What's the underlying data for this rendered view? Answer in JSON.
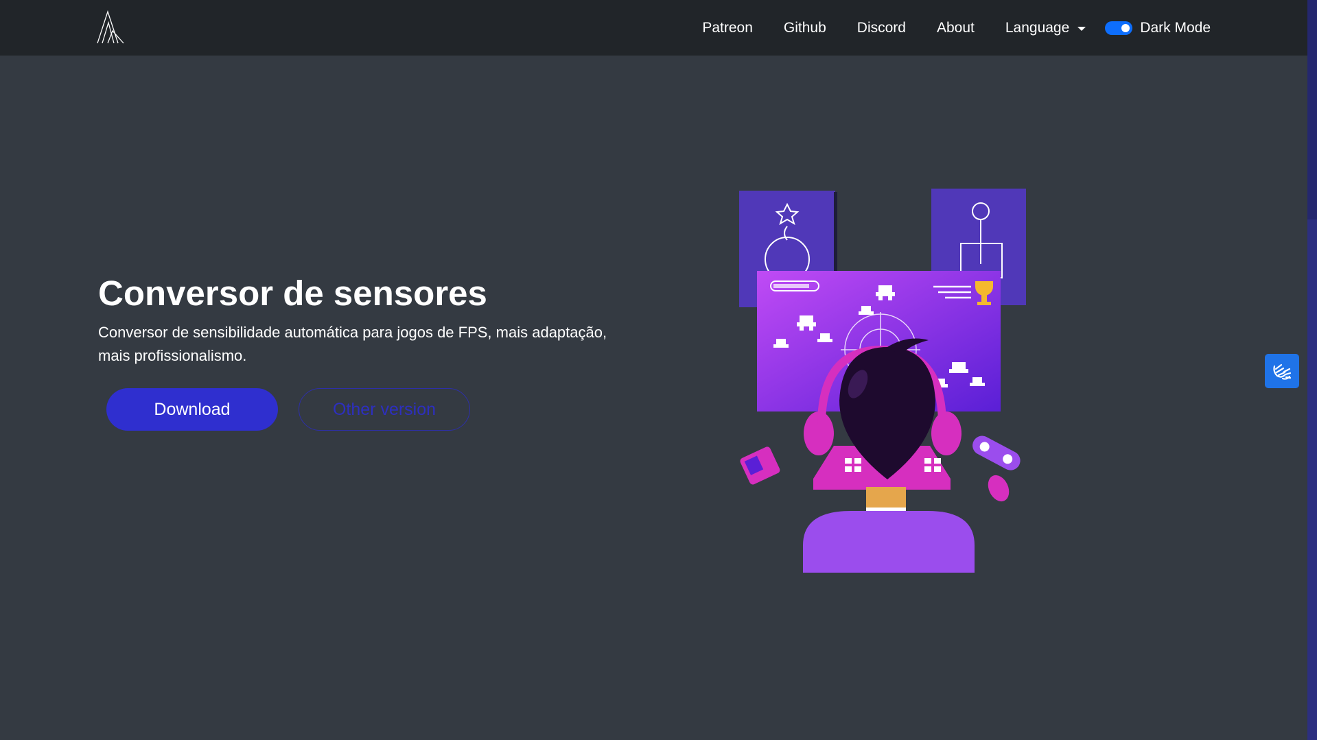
{
  "navbar": {
    "links": [
      "Patreon",
      "Github",
      "Discord",
      "About"
    ],
    "language_label": "Language",
    "dark_mode_label": "Dark Mode",
    "dark_mode_on": true
  },
  "hero": {
    "title": "Conversor de sensores",
    "subtitle": "Conversor de sensibilidade automática para jogos de FPS, mais adaptação, mais profissionalismo.",
    "download_label": "Download",
    "other_version_label": "Other version"
  },
  "colors": {
    "background": "#343a42",
    "navbar": "#212529",
    "primary_button": "#2f2fcf",
    "toggle": "#0d6efd",
    "accessibility_widget": "#1f73e8"
  },
  "icons": {
    "logo": "triangle-lines-logo",
    "accessibility": "sign-language-hands-icon"
  }
}
